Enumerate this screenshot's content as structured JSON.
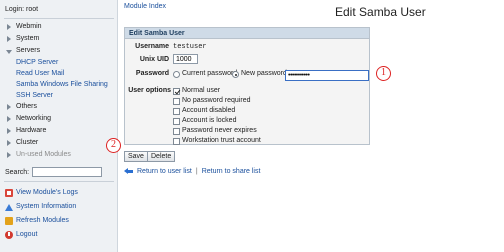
{
  "sidebar": {
    "login": "Login: root",
    "items": [
      {
        "label": "Webmin"
      },
      {
        "label": "System"
      },
      {
        "label": "Servers"
      },
      {
        "label": "Others"
      },
      {
        "label": "Networking"
      },
      {
        "label": "Hardware"
      },
      {
        "label": "Cluster"
      },
      {
        "label": "Un-used Modules"
      }
    ],
    "servers_sub": [
      "DHCP Server",
      "Read User Mail",
      "Samba Windows File Sharing",
      "SSH Server"
    ],
    "search_label": "Search:",
    "search_value": "",
    "links": [
      {
        "label": "View Module's Logs",
        "icon": "logs-icon"
      },
      {
        "label": "System Information",
        "icon": "system-info-icon"
      },
      {
        "label": "Refresh Modules",
        "icon": "refresh-icon"
      },
      {
        "label": "Logout",
        "icon": "logout-icon"
      }
    ]
  },
  "header": {
    "module_index": "Module Index",
    "title": "Edit Samba User"
  },
  "form": {
    "heading": "Edit Samba User",
    "username_label": "Username",
    "username_value": "testuser",
    "uid_label": "Unix UID",
    "uid_value": "1000",
    "password_label": "Password",
    "pw_current": "Current password",
    "pw_new": "New password",
    "pw_value": "•••••••••••",
    "options_label": "User options",
    "options": [
      {
        "label": "Normal user",
        "checked": true
      },
      {
        "label": "No password required",
        "checked": false
      },
      {
        "label": "Account disabled",
        "checked": false
      },
      {
        "label": "Account is locked",
        "checked": false
      },
      {
        "label": "Password never expires",
        "checked": false
      },
      {
        "label": "Workstation trust account",
        "checked": false
      }
    ],
    "save": "Save",
    "delete": "Delete"
  },
  "callouts": [
    "1",
    "2"
  ],
  "returns": {
    "user_list": "Return to user list",
    "separator": "|",
    "share_list": "Return to share list"
  },
  "colors": {
    "link": "#1a4f9c",
    "callout": "#d22222",
    "panel_head": "#cfdbe7"
  }
}
